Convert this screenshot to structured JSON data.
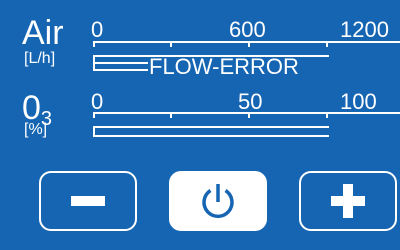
{
  "air": {
    "title": "Air",
    "unit": "[L/h]",
    "ticks": [
      "0",
      "600",
      "1200"
    ],
    "status": "FLOW-ERROR"
  },
  "ozone": {
    "title_main": "0",
    "title_sub": "3",
    "unit": "[%]",
    "ticks": [
      "0",
      "50",
      "100"
    ]
  },
  "buttons": {
    "decrease": "minus-icon",
    "power": "power-icon",
    "increase": "plus-icon"
  },
  "colors": {
    "background": "#1565b3",
    "foreground": "#ffffff"
  }
}
